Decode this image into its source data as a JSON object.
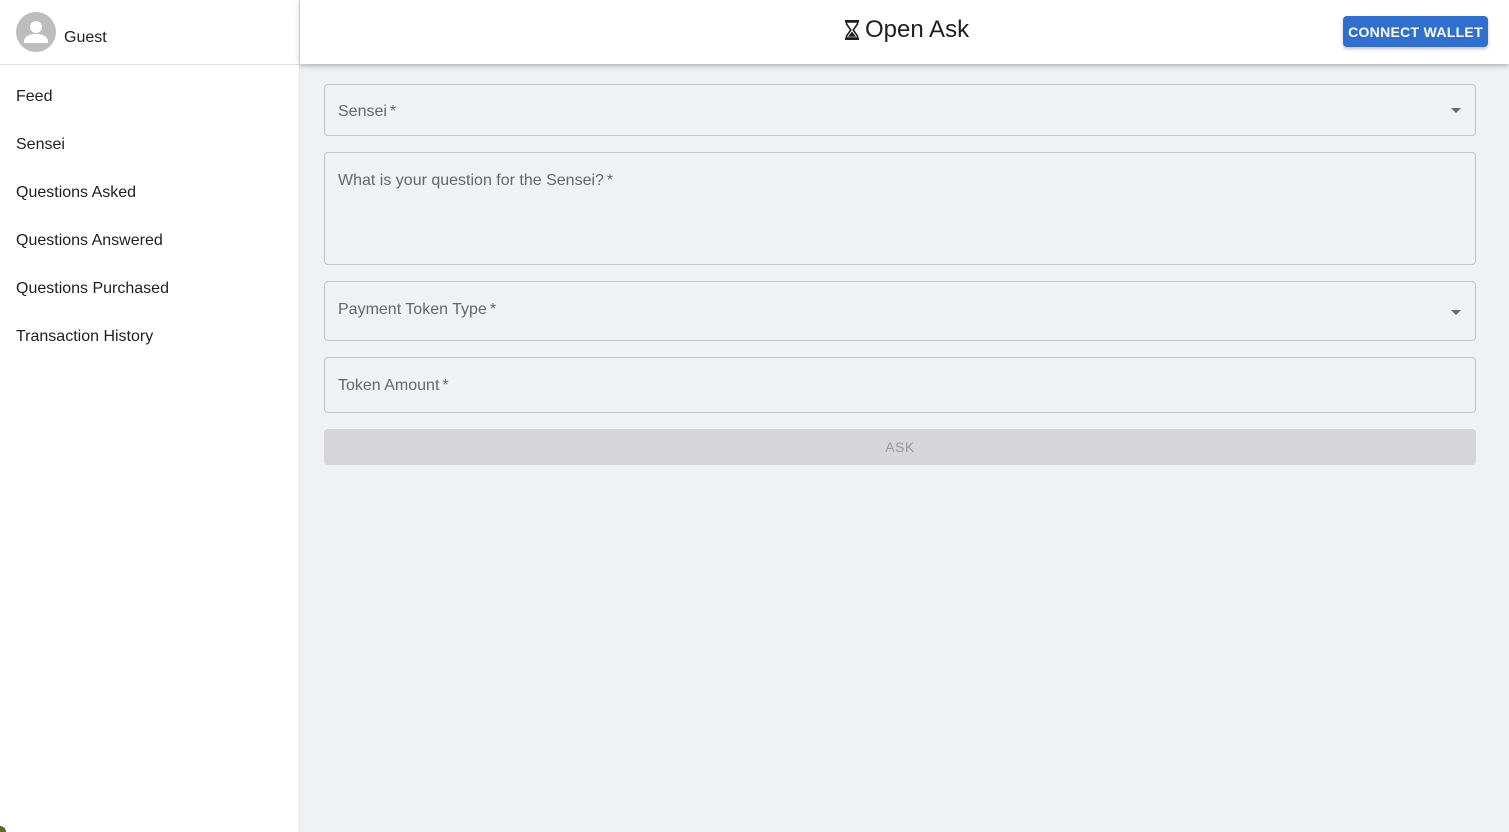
{
  "sidebar": {
    "user": {
      "name": "Guest",
      "avatar_icon": "person-icon"
    },
    "items": [
      {
        "label": "Feed"
      },
      {
        "label": "Sensei"
      },
      {
        "label": "Questions Asked"
      },
      {
        "label": "Questions Answered"
      },
      {
        "label": "Questions Purchased"
      },
      {
        "label": "Transaction History"
      }
    ]
  },
  "header": {
    "brand_icon": "hourglass-icon",
    "title": "Open Ask",
    "connect_label": "CONNECT WALLET",
    "accent_color": "#2f6fd0"
  },
  "form": {
    "sensei": {
      "label": "Sensei",
      "required_mark": "*"
    },
    "question": {
      "label": "What is your question for the Sensei?",
      "required_mark": "*"
    },
    "payment_token": {
      "label": "Payment Token Type",
      "required_mark": "*"
    },
    "token_amount": {
      "label": "Token Amount",
      "required_mark": "*"
    },
    "ask_label": "ASK"
  }
}
